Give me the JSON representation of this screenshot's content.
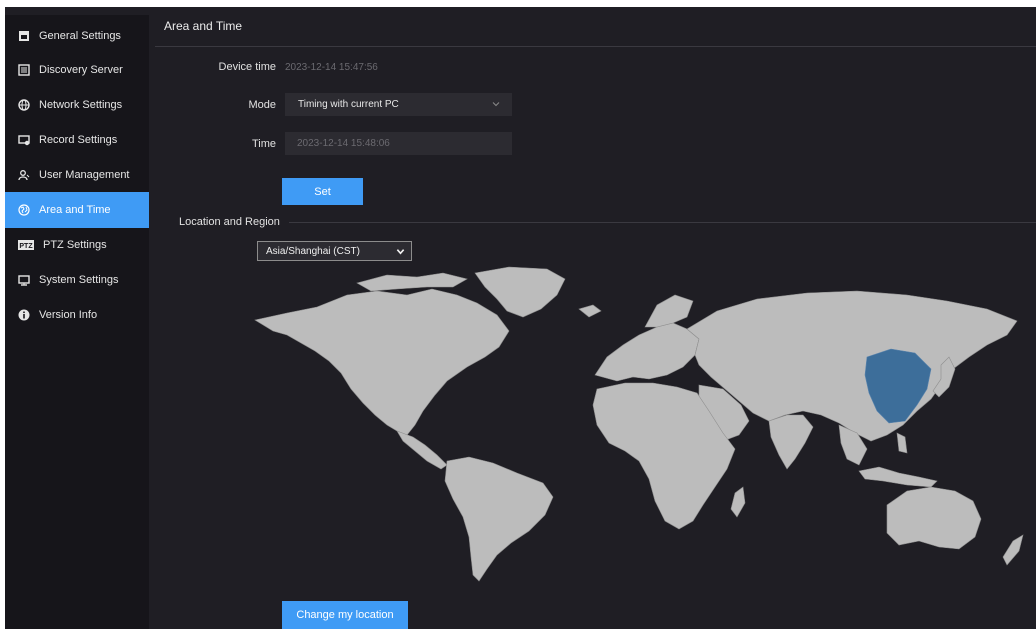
{
  "sidebar": {
    "items": [
      {
        "label": "General Settings",
        "icon": "general-settings-icon",
        "active": false
      },
      {
        "label": "Discovery Server",
        "icon": "server-icon",
        "active": false
      },
      {
        "label": "Network Settings",
        "icon": "globe-icon",
        "active": false
      },
      {
        "label": "Record Settings",
        "icon": "record-icon",
        "active": false
      },
      {
        "label": "User Management",
        "icon": "users-icon",
        "active": false
      },
      {
        "label": "Area and Time",
        "icon": "area-time-icon",
        "active": true
      },
      {
        "label": "PTZ Settings",
        "icon": "ptz-icon",
        "active": false
      },
      {
        "label": "System Settings",
        "icon": "system-icon",
        "active": false
      },
      {
        "label": "Version Info",
        "icon": "info-icon",
        "active": false
      }
    ],
    "ptz_badge": "PTZ"
  },
  "main": {
    "title": "Area and Time",
    "device_time_label": "Device time",
    "device_time_value": "2023-12-14 15:47:56",
    "mode_label": "Mode",
    "mode_value": "Timing with current PC",
    "time_label": "Time",
    "time_value": "2023-12-14 15:48:06",
    "set_button": "Set",
    "location_section": "Location and Region",
    "timezone_value": "Asia/Shanghai (CST)",
    "change_location_button": "Change my location"
  },
  "colors": {
    "accent": "#3f9bf5",
    "sidebar_bg": "#16151a",
    "panel_bg": "#1f1e24",
    "map_land": "#bcbcbc",
    "map_highlight": "#3d6e9a"
  }
}
